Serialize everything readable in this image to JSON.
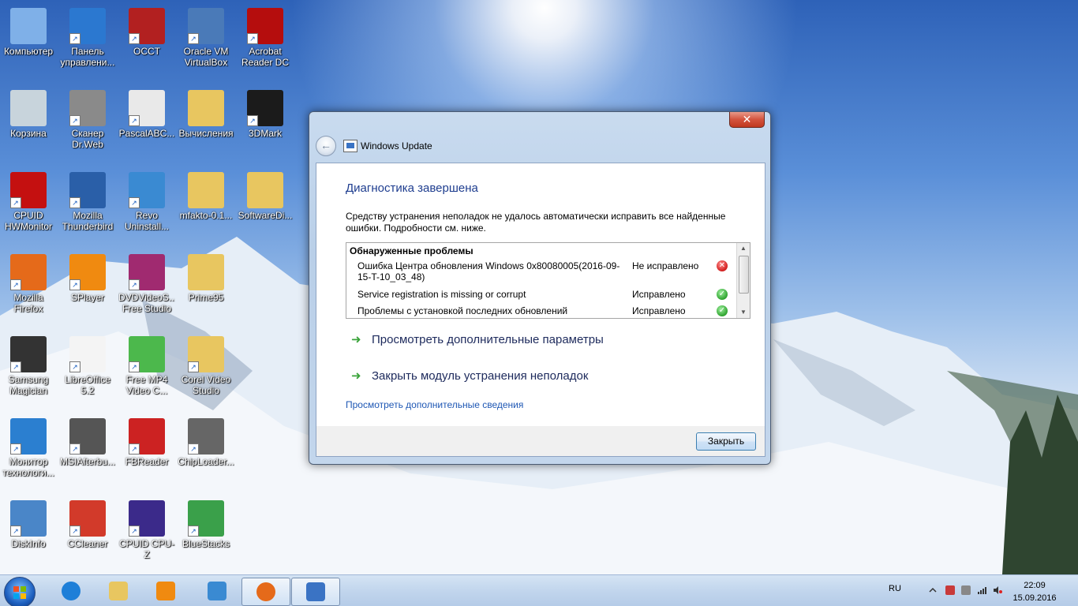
{
  "desktop": {
    "icons": [
      {
        "label": "Компьютер",
        "color": "#7fb0e8",
        "shortcut": false
      },
      {
        "label": "Панель управлени...",
        "color": "#2b78d0",
        "shortcut": true
      },
      {
        "label": "OCCT",
        "color": "#b22020",
        "shortcut": true
      },
      {
        "label": "Oracle VM VirtualBox",
        "color": "#4a7ab8",
        "shortcut": true
      },
      {
        "label": "Acrobat Reader DC",
        "color": "#b50d0d",
        "shortcut": true
      },
      {
        "label": "Корзина",
        "color": "#c8d4dc",
        "shortcut": false
      },
      {
        "label": "Сканер Dr.Web",
        "color": "#8a8a8a",
        "shortcut": true
      },
      {
        "label": "PascalABC...",
        "color": "#e9e9e9",
        "shortcut": true
      },
      {
        "label": "Вычисления",
        "color": "#e8c660",
        "shortcut": false
      },
      {
        "label": "3DMark",
        "color": "#1b1b1b",
        "shortcut": true
      },
      {
        "label": "CPUID HWMonitor",
        "color": "#c41010",
        "shortcut": true
      },
      {
        "label": "Mozilla Thunderbird",
        "color": "#2a5fa8",
        "shortcut": true
      },
      {
        "label": "Revo Uninstall...",
        "color": "#3a8ad2",
        "shortcut": true
      },
      {
        "label": "mfakto-0.1...",
        "color": "#e8c660",
        "shortcut": false
      },
      {
        "label": "SoftwareDi...",
        "color": "#e8c660",
        "shortcut": false
      },
      {
        "label": "Mozilla Firefox",
        "color": "#e56a1a",
        "shortcut": true
      },
      {
        "label": "SPlayer",
        "color": "#f08a10",
        "shortcut": true
      },
      {
        "label": "DVDVideoS... Free Studio",
        "color": "#a02a70",
        "shortcut": true
      },
      {
        "label": "Prime95",
        "color": "#e8c660",
        "shortcut": false
      },
      {
        "label": "Samsung Magician",
        "color": "#333333",
        "shortcut": true
      },
      {
        "label": "LibreOffice 5.2",
        "color": "#f4f4f4",
        "shortcut": true
      },
      {
        "label": "Free MP4 Video C...",
        "color": "#4cb84c",
        "shortcut": true
      },
      {
        "label": "Corel Video Studio",
        "color": "#e8c660",
        "shortcut": true
      },
      {
        "label": "Монитор технологи...",
        "color": "#2b7fd0",
        "shortcut": true
      },
      {
        "label": "MSIAfterbu...",
        "color": "#555555",
        "shortcut": true
      },
      {
        "label": "FBReader",
        "color": "#cc2222",
        "shortcut": true
      },
      {
        "label": "ChipLoader...",
        "color": "#666666",
        "shortcut": true
      },
      {
        "label": "DiskInfo",
        "color": "#4a86c8",
        "shortcut": true
      },
      {
        "label": "CCleaner",
        "color": "#d23a2a",
        "shortcut": true
      },
      {
        "label": "CPUID CPU-Z",
        "color": "#3b2a8a",
        "shortcut": true
      },
      {
        "label": "BlueStacks",
        "color": "#3aa04a",
        "shortcut": true
      }
    ]
  },
  "window": {
    "close_glyph": "✕",
    "back_glyph": "←",
    "app_title": "Windows Update",
    "heading": "Диагностика завершена",
    "description": "Средству устранения неполадок не удалось автоматически исправить все найденные ошибки. Подробности см. ниже.",
    "problems": {
      "header": "Обнаруженные проблемы",
      "rows": [
        {
          "name": "Ошибка Центра обновления Windows 0x80080005(2016-09-15-T-10_03_48)",
          "status": "Не исправлено",
          "ok": false
        },
        {
          "name": "Service registration is missing or corrupt",
          "status": "Исправлено",
          "ok": true
        },
        {
          "name": "Проблемы с установкой последних обновлений",
          "status": "Исправлено",
          "ok": true
        }
      ]
    },
    "links": {
      "view_more_params": "Просмотреть дополнительные параметры",
      "close_troubleshooter": "Закрыть модуль устранения неполадок",
      "more_info": "Просмотреть дополнительные сведения"
    },
    "close_button": "Закрыть"
  },
  "taskbar": {
    "items": [
      {
        "name": "ie",
        "color": "#1e7fd8",
        "active": false
      },
      {
        "name": "explorer",
        "color": "#e8c660",
        "active": false
      },
      {
        "name": "media-player",
        "color": "#f08a10",
        "active": false
      },
      {
        "name": "control-panel",
        "color": "#3a8ad2",
        "active": false
      },
      {
        "name": "firefox",
        "color": "#e56a1a",
        "active": true
      },
      {
        "name": "windows-update",
        "color": "#3a73c4",
        "active": true
      }
    ],
    "tray": {
      "lang": "RU",
      "time": "22:09",
      "date": "15.09.2016"
    }
  }
}
